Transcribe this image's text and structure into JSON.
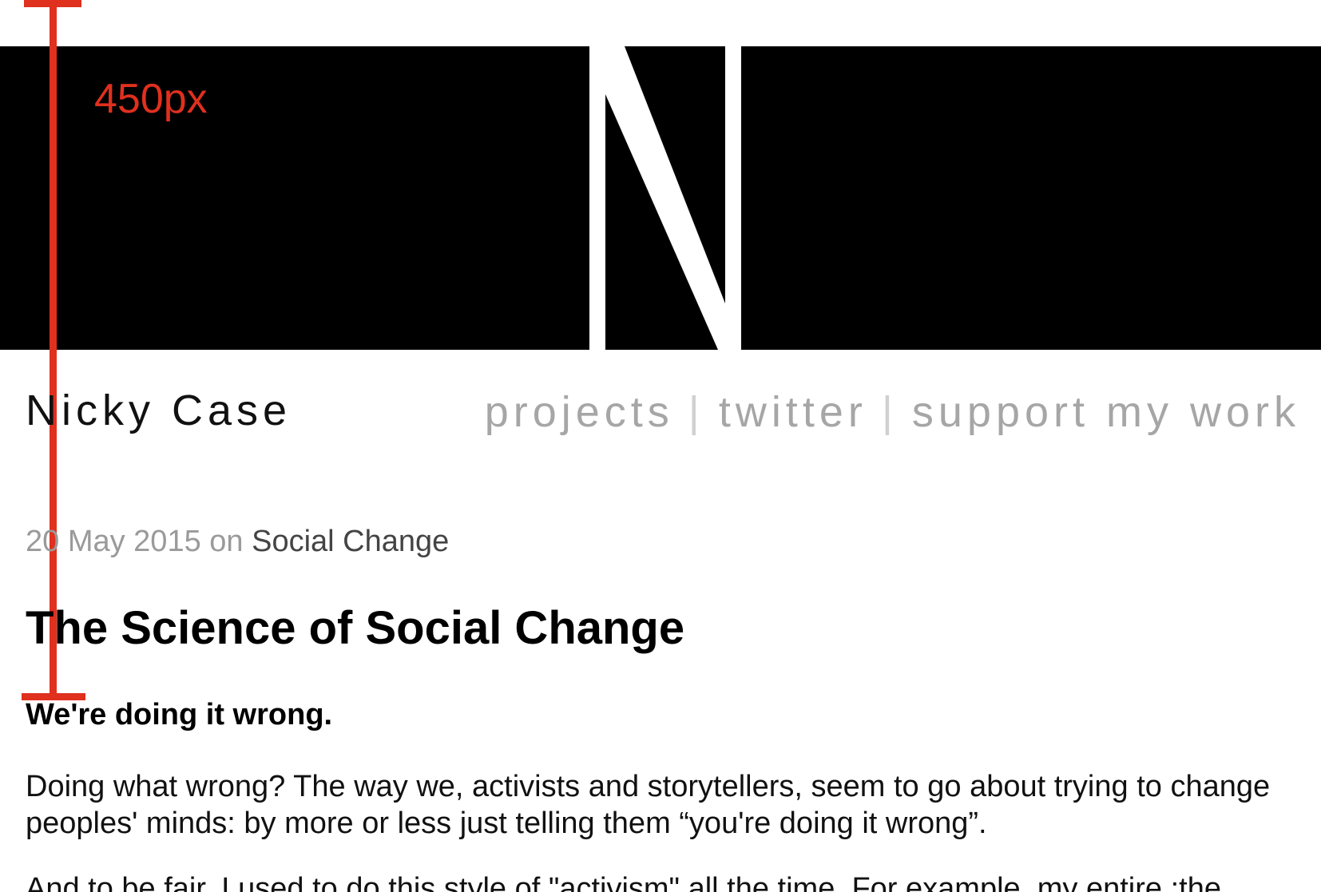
{
  "annotation": {
    "measure_label": "450px",
    "color": "#e0301e"
  },
  "banner": {
    "logo": "N-logo",
    "background": "#000000"
  },
  "header": {
    "site_name": "Nicky Case",
    "nav": [
      {
        "label": "projects"
      },
      {
        "label": "twitter"
      },
      {
        "label": "support my work"
      }
    ],
    "separator": "|"
  },
  "post": {
    "date": "20 May 2015",
    "on": "on",
    "category": "Social Change",
    "title": "The Science of Social Change",
    "subtitle": "We're doing it wrong.",
    "paragraphs": [
      "Doing what wrong? The way we, activists and storytellers, seem to go about trying to change peoples' minds: by more or less just telling them “you're doing it wrong”.",
      "And to be fair, I used to do this style of \"activism\" all the time. For example, my entire :the"
    ]
  }
}
